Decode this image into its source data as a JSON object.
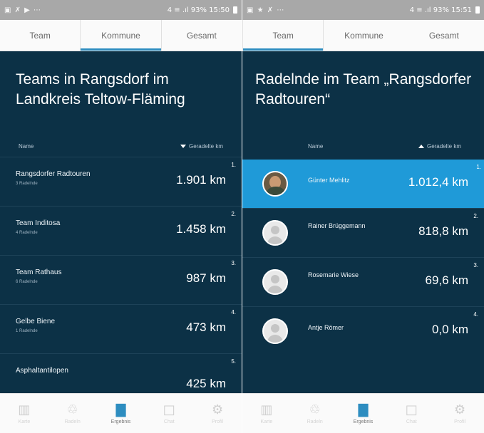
{
  "status": {
    "left": {
      "icons": "▣ ✗ ▶ ⋯"
    },
    "right": {
      "text": "4 ≡ .ıl 93% 15:50",
      "battery": "battery-icon"
    },
    "right2": {
      "icons": "▣ ★ ✗ ⋯",
      "text": "4 ≡ .ıl 93% 15:51"
    }
  },
  "left": {
    "tabs": [
      {
        "label": "Team"
      },
      {
        "label": "Kommune"
      },
      {
        "label": "Gesamt"
      }
    ],
    "active_tab": 1,
    "heading": "Teams in Rangsdorf im Landkreis Teltow-Fläming",
    "col_name": "Name",
    "col_km": "Geradelte km",
    "teams": [
      {
        "rank": "1.",
        "name": "Rangsdorfer Radtouren",
        "sub": "3 Radelnde",
        "km": "1.901 km"
      },
      {
        "rank": "2.",
        "name": "Team Inditosa",
        "sub": "4 Radelnde",
        "km": "1.458 km"
      },
      {
        "rank": "3.",
        "name": "Team Rathaus",
        "sub": "6 Radelnde",
        "km": "987 km"
      },
      {
        "rank": "4.",
        "name": "Gelbe Biene",
        "sub": "1 Radelnde",
        "km": "473 km"
      },
      {
        "rank": "5.",
        "name": "Asphaltantilopen",
        "sub": "",
        "km": "425 km"
      }
    ]
  },
  "right": {
    "tabs": [
      {
        "label": "Team"
      },
      {
        "label": "Kommune"
      },
      {
        "label": "Gesamt"
      }
    ],
    "active_tab": 0,
    "heading": "Radelnde im Team „Rangsdorfer Radtouren“",
    "col_name": "Name",
    "col_km": "Geradelte km",
    "members": [
      {
        "rank": "1.",
        "name": "Günter Mehlitz",
        "km": "1.012,4 km",
        "avatar": "photo"
      },
      {
        "rank": "2.",
        "name": "Rainer Brüggemann",
        "km": "818,8 km",
        "avatar": "placeholder"
      },
      {
        "rank": "3.",
        "name": "Rosemarie Wiese",
        "km": "69,6 km",
        "avatar": "placeholder"
      },
      {
        "rank": "4.",
        "name": "Antje Römer",
        "km": "0,0 km",
        "avatar": "placeholder"
      }
    ]
  },
  "nav": [
    {
      "label": "Karte",
      "icon": "map-icon",
      "glyph": "▥"
    },
    {
      "label": "Radeln",
      "icon": "bicycle-icon",
      "glyph": "♲"
    },
    {
      "label": "Ergebnis",
      "icon": "bar-chart-icon",
      "glyph": "▇"
    },
    {
      "label": "Chat",
      "icon": "chat-icon",
      "glyph": "□"
    },
    {
      "label": "Profil",
      "icon": "settings-icon",
      "glyph": "⚙"
    }
  ],
  "nav_active": 2,
  "colors": {
    "background": "#0c3146",
    "accent": "#2d8dc0",
    "highlight_row": "#1f9ad8"
  }
}
